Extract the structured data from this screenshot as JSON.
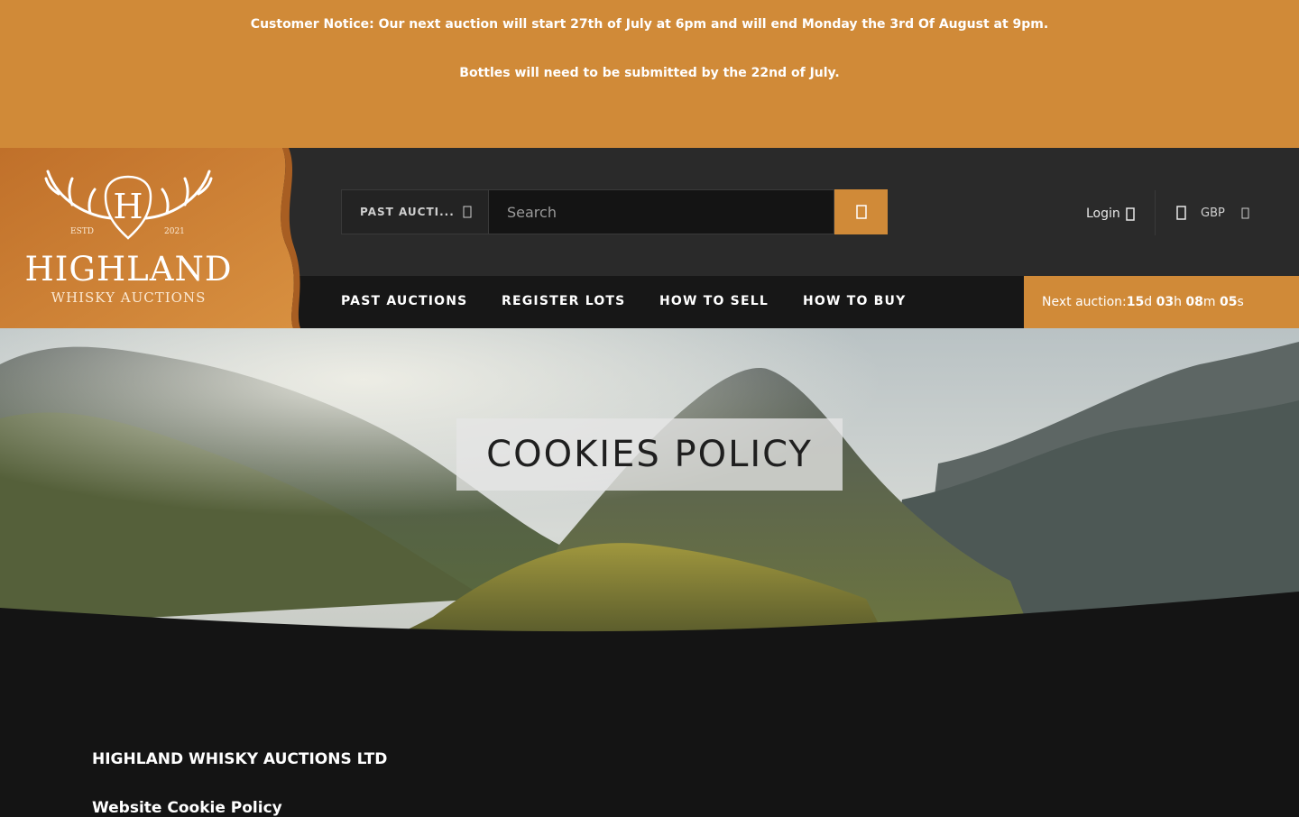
{
  "notice": {
    "line1": "Customer Notice: Our next auction will start 27th of July at 6pm and will end Monday the 3rd Of August at 9pm.",
    "line2": "Bottles will need to be submitted by the 22nd of July."
  },
  "logo": {
    "name": "HIGHLAND",
    "tagline": "WHISKY AUCTIONS",
    "estd": "ESTD",
    "year": "2021",
    "monogram": "H"
  },
  "search": {
    "auction_select": "PAST AUCTI...",
    "placeholder": "Search",
    "search_icon": "search-icon"
  },
  "account": {
    "login_label": "Login",
    "login_icon": "user-icon",
    "currency": "GBP",
    "cart_icon": "basket-icon"
  },
  "nav": {
    "items": [
      "PAST AUCTIONS",
      "REGISTER LOTS",
      "HOW TO SELL",
      "HOW TO BUY"
    ]
  },
  "countdown": {
    "label": "Next auction: ",
    "days": "15",
    "days_unit": "d",
    "hours": "03",
    "hours_unit": "h",
    "minutes": "08",
    "minutes_unit": "m",
    "seconds": "05",
    "seconds_unit": "s"
  },
  "hero": {
    "title": "COOKIES POLICY"
  },
  "content": {
    "company": "HIGHLAND WHISKY AUCTIONS LTD",
    "subtitle": "Website Cookie Policy"
  },
  "colors": {
    "accent": "#d08a38",
    "header_bg": "#2a2a2a",
    "page_bg": "#141414"
  }
}
